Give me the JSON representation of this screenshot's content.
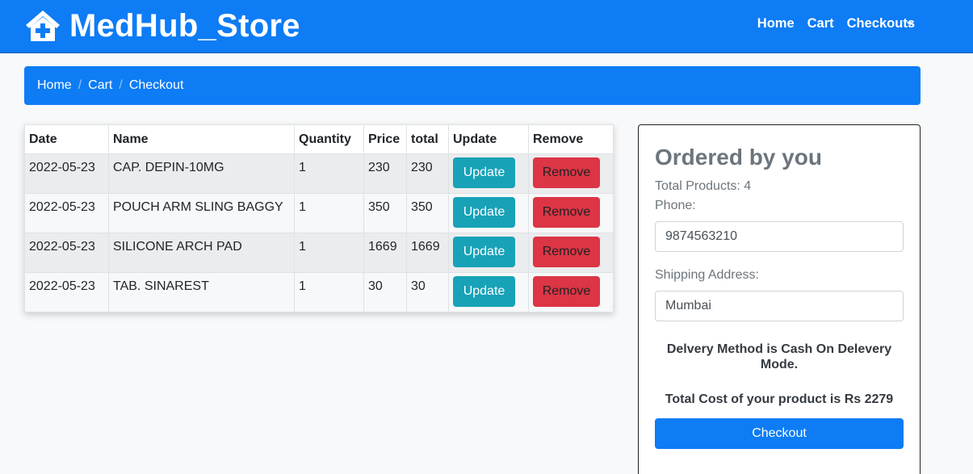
{
  "navbar": {
    "brand": "MedHub_Store",
    "links": [
      "Home",
      "Cart",
      "Checkouts"
    ]
  },
  "breadcrumb": [
    "Home",
    "Cart",
    "Checkout"
  ],
  "table": {
    "headers": [
      "Date",
      "Name",
      "Quantity",
      "Price",
      "total",
      "Update",
      "Remove"
    ],
    "rows": [
      {
        "date": "2022-05-23",
        "name": "CAP. DEPIN-10MG",
        "quantity": "1",
        "price": "230",
        "total": "230",
        "update": "Update",
        "remove": "Remove"
      },
      {
        "date": "2022-05-23",
        "name": "POUCH ARM SLING BAGGY",
        "quantity": "1",
        "price": "350",
        "total": "350",
        "update": "Update",
        "remove": "Remove"
      },
      {
        "date": "2022-05-23",
        "name": "SILICONE ARCH PAD",
        "quantity": "1",
        "price": "1669",
        "total": "1669",
        "update": "Update",
        "remove": "Remove"
      },
      {
        "date": "2022-05-23",
        "name": "TAB. SINAREST",
        "quantity": "1",
        "price": "30",
        "total": "30",
        "update": "Update",
        "remove": "Remove"
      }
    ]
  },
  "order": {
    "title": "Ordered by you",
    "total_products": "Total Products: 4",
    "phone_label": "Phone:",
    "phone_value": "9874563210",
    "address_label": "Shipping Address:",
    "address_value": "Mumbai",
    "delivery_note": "Delvery Method is Cash On Delevery Mode.",
    "total_cost": "Total Cost of your product is Rs 2279",
    "checkout_label": "Checkout"
  },
  "colors": {
    "primary": "#0d7cf5",
    "info": "#17a2b8",
    "danger": "#dc3545"
  },
  "icons": {
    "brand_icon": "house-medical-icon",
    "dropdown": "caret-down-icon"
  }
}
